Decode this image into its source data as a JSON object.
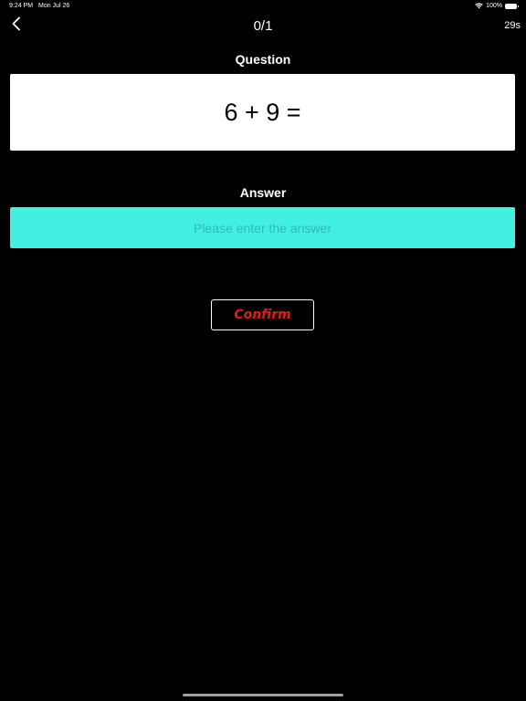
{
  "status_bar": {
    "time": "9:24 PM",
    "date": "Mon Jul 26",
    "battery_percent": "100%",
    "battery_level": 1.0
  },
  "nav": {
    "back_icon": "chevron-left-icon",
    "title": "0/1",
    "timer": "29s"
  },
  "question": {
    "label": "Question",
    "text": "6 + 9 ="
  },
  "answer": {
    "label": "Answer",
    "value": "",
    "placeholder": "Please enter the answer"
  },
  "actions": {
    "confirm_label": "Confirm"
  },
  "colors": {
    "background": "#000000",
    "answer_field": "#42efe1",
    "confirm_text": "#e81a14"
  }
}
